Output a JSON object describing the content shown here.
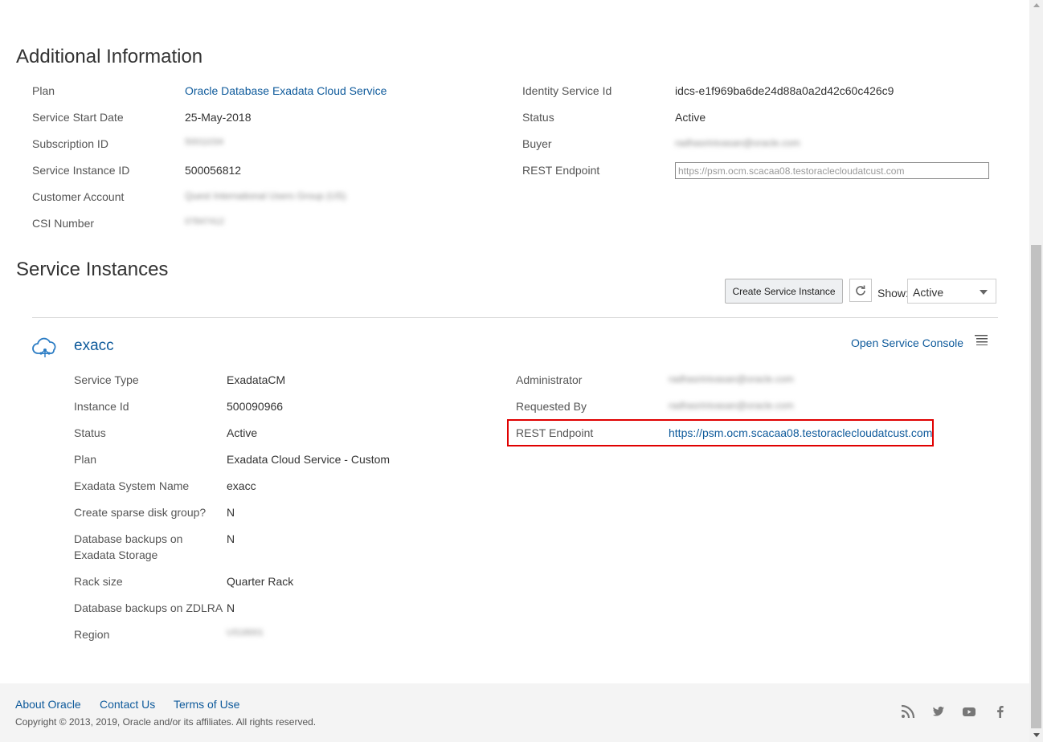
{
  "additional_info": {
    "title": "Additional Information",
    "left": [
      {
        "label": "Plan",
        "value": "Oracle Database Exadata Cloud Service"
      },
      {
        "label": "Service Start Date",
        "value": "25-May-2018"
      },
      {
        "label": "Subscription ID",
        "value": "50011034"
      },
      {
        "label": "Service Instance ID",
        "value": "500056812"
      },
      {
        "label": "Customer Account",
        "value": "Quest International Users Group (US)"
      },
      {
        "label": "CSI Number",
        "value": "07847412"
      }
    ],
    "right": [
      {
        "label": "Identity Service Id",
        "value": "idcs-e1f969ba6de24d88a0a2d42c60c426c9"
      },
      {
        "label": "Status",
        "value": "Active"
      },
      {
        "label": "Buyer",
        "value": "radhasrinivasan@oracle.com"
      },
      {
        "label": "REST Endpoint",
        "value": "https://psm.ocm.scacaa08.testoraclecloudatcust.com"
      }
    ]
  },
  "service_instances": {
    "title": "Service Instances",
    "create_button": "Create Service Instance",
    "show_label": "Show:",
    "show_value": "Active"
  },
  "instance": {
    "name": "exacc",
    "open_console": "Open Service Console",
    "left": [
      {
        "label": "Service Type",
        "value": "ExadataCM"
      },
      {
        "label": "Instance Id",
        "value": "500090966"
      },
      {
        "label": "Status",
        "value": "Active"
      },
      {
        "label": "Plan",
        "value": "Exadata Cloud Service - Custom"
      },
      {
        "label": "Exadata System Name",
        "value": "exacc"
      },
      {
        "label": "Create sparse disk group?",
        "value": "N"
      },
      {
        "label": "Database backups on",
        "label2": "Exadata Storage",
        "value": "N"
      },
      {
        "label": "Rack size",
        "value": "Quarter Rack"
      },
      {
        "label": "Database backups on ZDLRA",
        "value": "N"
      },
      {
        "label": "Region",
        "value": "US18001"
      }
    ],
    "right": [
      {
        "label": "Administrator",
        "value": "radhasrinivasan@oracle.com"
      },
      {
        "label": "Requested By",
        "value": "radhasrinivasan@oracle.com"
      },
      {
        "label": "REST Endpoint",
        "value": "https://psm.ocm.scacaa08.testoraclecloudatcust.com"
      }
    ]
  },
  "footer": {
    "links": [
      "About Oracle",
      "Contact Us",
      "Terms of Use"
    ],
    "copyright": "Copyright © 2013, 2019, Oracle and/or its affiliates. All rights reserved.",
    "social": [
      "rss-icon",
      "twitter-icon",
      "youtube-icon",
      "facebook-icon"
    ]
  },
  "colors": {
    "link": "#0e5a9b",
    "highlight": "#e00000"
  }
}
